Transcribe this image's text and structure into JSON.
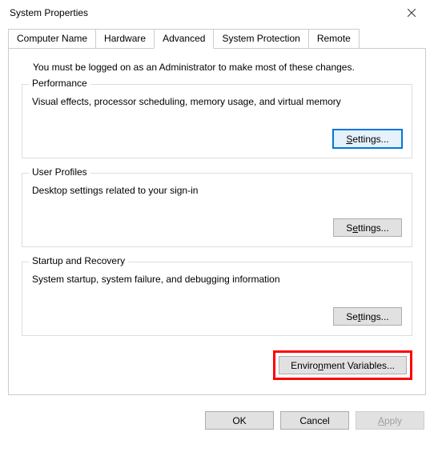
{
  "window": {
    "title": "System Properties"
  },
  "tabs": [
    {
      "label": "Computer Name"
    },
    {
      "label": "Hardware"
    },
    {
      "label": "Advanced"
    },
    {
      "label": "System Protection"
    },
    {
      "label": "Remote"
    }
  ],
  "advanced": {
    "intro": "You must be logged on as an Administrator to make most of these changes.",
    "performance": {
      "legend": "Performance",
      "desc": "Visual effects, processor scheduling, memory usage, and virtual memory",
      "button_prefix": "S",
      "button_rest": "ettings..."
    },
    "userprofiles": {
      "legend": "User Profiles",
      "desc": "Desktop settings related to your sign-in",
      "button_prefix": "S",
      "button_u": "e",
      "button_rest": "ttings..."
    },
    "startup": {
      "legend": "Startup and Recovery",
      "desc": "System startup, system failure, and debugging information",
      "button_prefix": "Se",
      "button_u": "t",
      "button_rest": "tings..."
    },
    "envvars": {
      "button_prefix": "Enviro",
      "button_u": "n",
      "button_rest": "ment Variables..."
    }
  },
  "footer": {
    "ok": "OK",
    "cancel": "Cancel",
    "apply_u": "A",
    "apply_rest": "pply"
  }
}
